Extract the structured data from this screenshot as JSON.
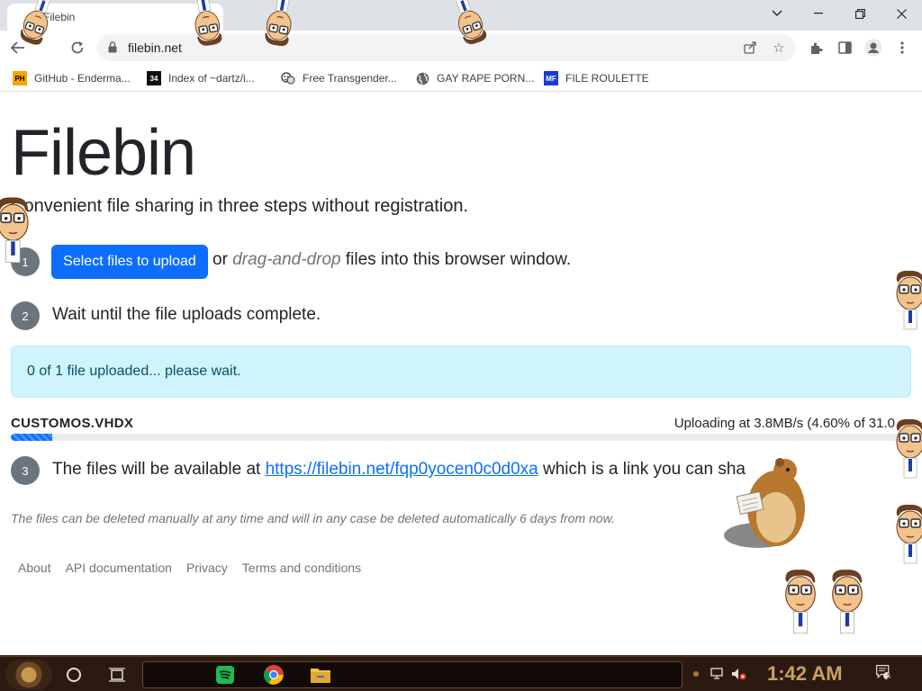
{
  "browser": {
    "tab_title": "Filebin",
    "url": "filebin.net",
    "window_controls": {
      "dropdown": "chevron-down-icon",
      "minimize": "minimize-icon",
      "maximize": "maximize-icon",
      "close": "close-icon"
    },
    "bookmarks": [
      {
        "label": "GitHub - Enderma...",
        "icon": "PH",
        "icon_bg": "#f7a600",
        "icon_fg": "#000000"
      },
      {
        "label": "Index of ~dartz/i...",
        "icon": "34",
        "icon_bg": "#111111",
        "icon_fg": "#ffffff"
      },
      {
        "label": "Free Transgender...",
        "icon": "theater-icon",
        "icon_bg": "#ffffff",
        "icon_fg": "#333333"
      },
      {
        "label": "GAY RAPE PORN...",
        "icon": "globe-icon",
        "icon_bg": "#ffffff",
        "icon_fg": "#5f6368"
      },
      {
        "label": "FILE ROULETTE",
        "icon": "MF",
        "icon_bg": "#1a3bd8",
        "icon_fg": "#ffffff"
      }
    ]
  },
  "page": {
    "brand": "Filebin",
    "lead": "Convenient file sharing in three steps without registration.",
    "step1": {
      "number": "1",
      "button": "Select files to upload",
      "or": "or",
      "emphasis": "drag-and-drop",
      "rest": "files into this browser window."
    },
    "step2": {
      "number": "2",
      "text": "Wait until the file uploads complete."
    },
    "alert": "0 of 1 file uploaded... please wait.",
    "file": {
      "name": "CUSTOMOS.VHDX",
      "status": "Uploading at 3.8MB/s (4.60% of 31.0",
      "progress_percent": 4.6
    },
    "step3": {
      "number": "3",
      "prefix": "The files will be available at",
      "link": "https://filebin.net/fqp0yocen0c0d0xa",
      "suffix": "which is a link you can sha"
    },
    "note": "The files can be deleted manually at any time and will in any case be deleted automatically 6 days from now.",
    "footer": [
      "About",
      "API documentation",
      "Privacy",
      "Terms and conditions"
    ]
  },
  "taskbar": {
    "clock": "1:42 AM",
    "notification_count": "2",
    "pinned": [
      "spotify-icon",
      "chrome-icon",
      "file-explorer-icon"
    ]
  },
  "colors": {
    "primary": "#0d6efd",
    "alert_bg": "#cff4fc",
    "alert_text": "#055160",
    "step_badge": "#6c757d",
    "clock": "#c9a063"
  }
}
